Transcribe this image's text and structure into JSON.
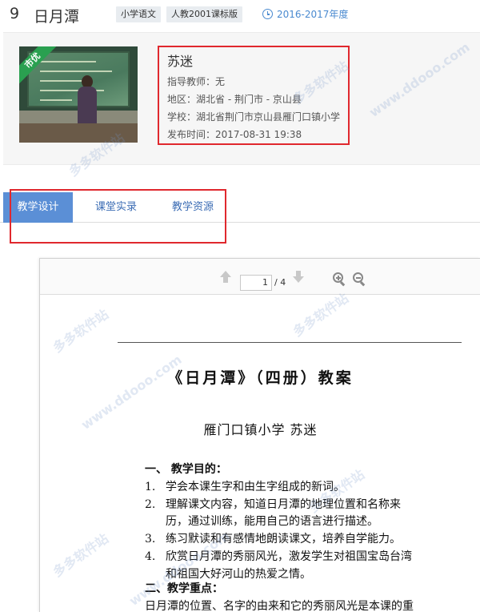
{
  "header": {
    "number": "9",
    "title": "日月潭",
    "tags": [
      "小学语文",
      "人教2001课标版"
    ],
    "year": "2016-2017年度"
  },
  "info": {
    "badge": "市优",
    "teacher": "苏迷",
    "guide_teacher": "指导教师：无",
    "region": "地区：湖北省 - 荆门市 - 京山县",
    "school": "学校：湖北省荆门市京山县雁门口镇小学",
    "published": "发布时间：2017-08-31 19:38"
  },
  "tabs": [
    "教学设计",
    "课堂实录",
    "教学资源"
  ],
  "viewer": {
    "page_current": "1",
    "page_total": "/ 4"
  },
  "doc": {
    "title": "《日月潭》（四册）教案",
    "subtitle": "雁门口镇小学  苏迷",
    "section1": "一、   教学目的：",
    "items": [
      {
        "n": "1.",
        "t": "学会本课生字和由生字组成的新词。"
      },
      {
        "n": "2.",
        "t": "理解课文内容，知道日月潭的地理位置和名称来"
      },
      {
        "n": "3.",
        "t": "练习默读和有感情地朗读课文，培养自学能力。"
      },
      {
        "n": "4.",
        "t": "欣赏日月潭的秀丽风光，激发学生对祖国宝岛台湾"
      }
    ],
    "cont2": "历，通过训练，能用自己的语言进行描述。",
    "cont4": "和祖国大好河山的热爱之情。",
    "section2": "二、教学重点：",
    "para": "日月潭的位置、名字的由来和它的秀丽风光是本课的重"
  },
  "watermark": {
    "cn": "多多软件站",
    "en": "www.ddooo.com"
  }
}
